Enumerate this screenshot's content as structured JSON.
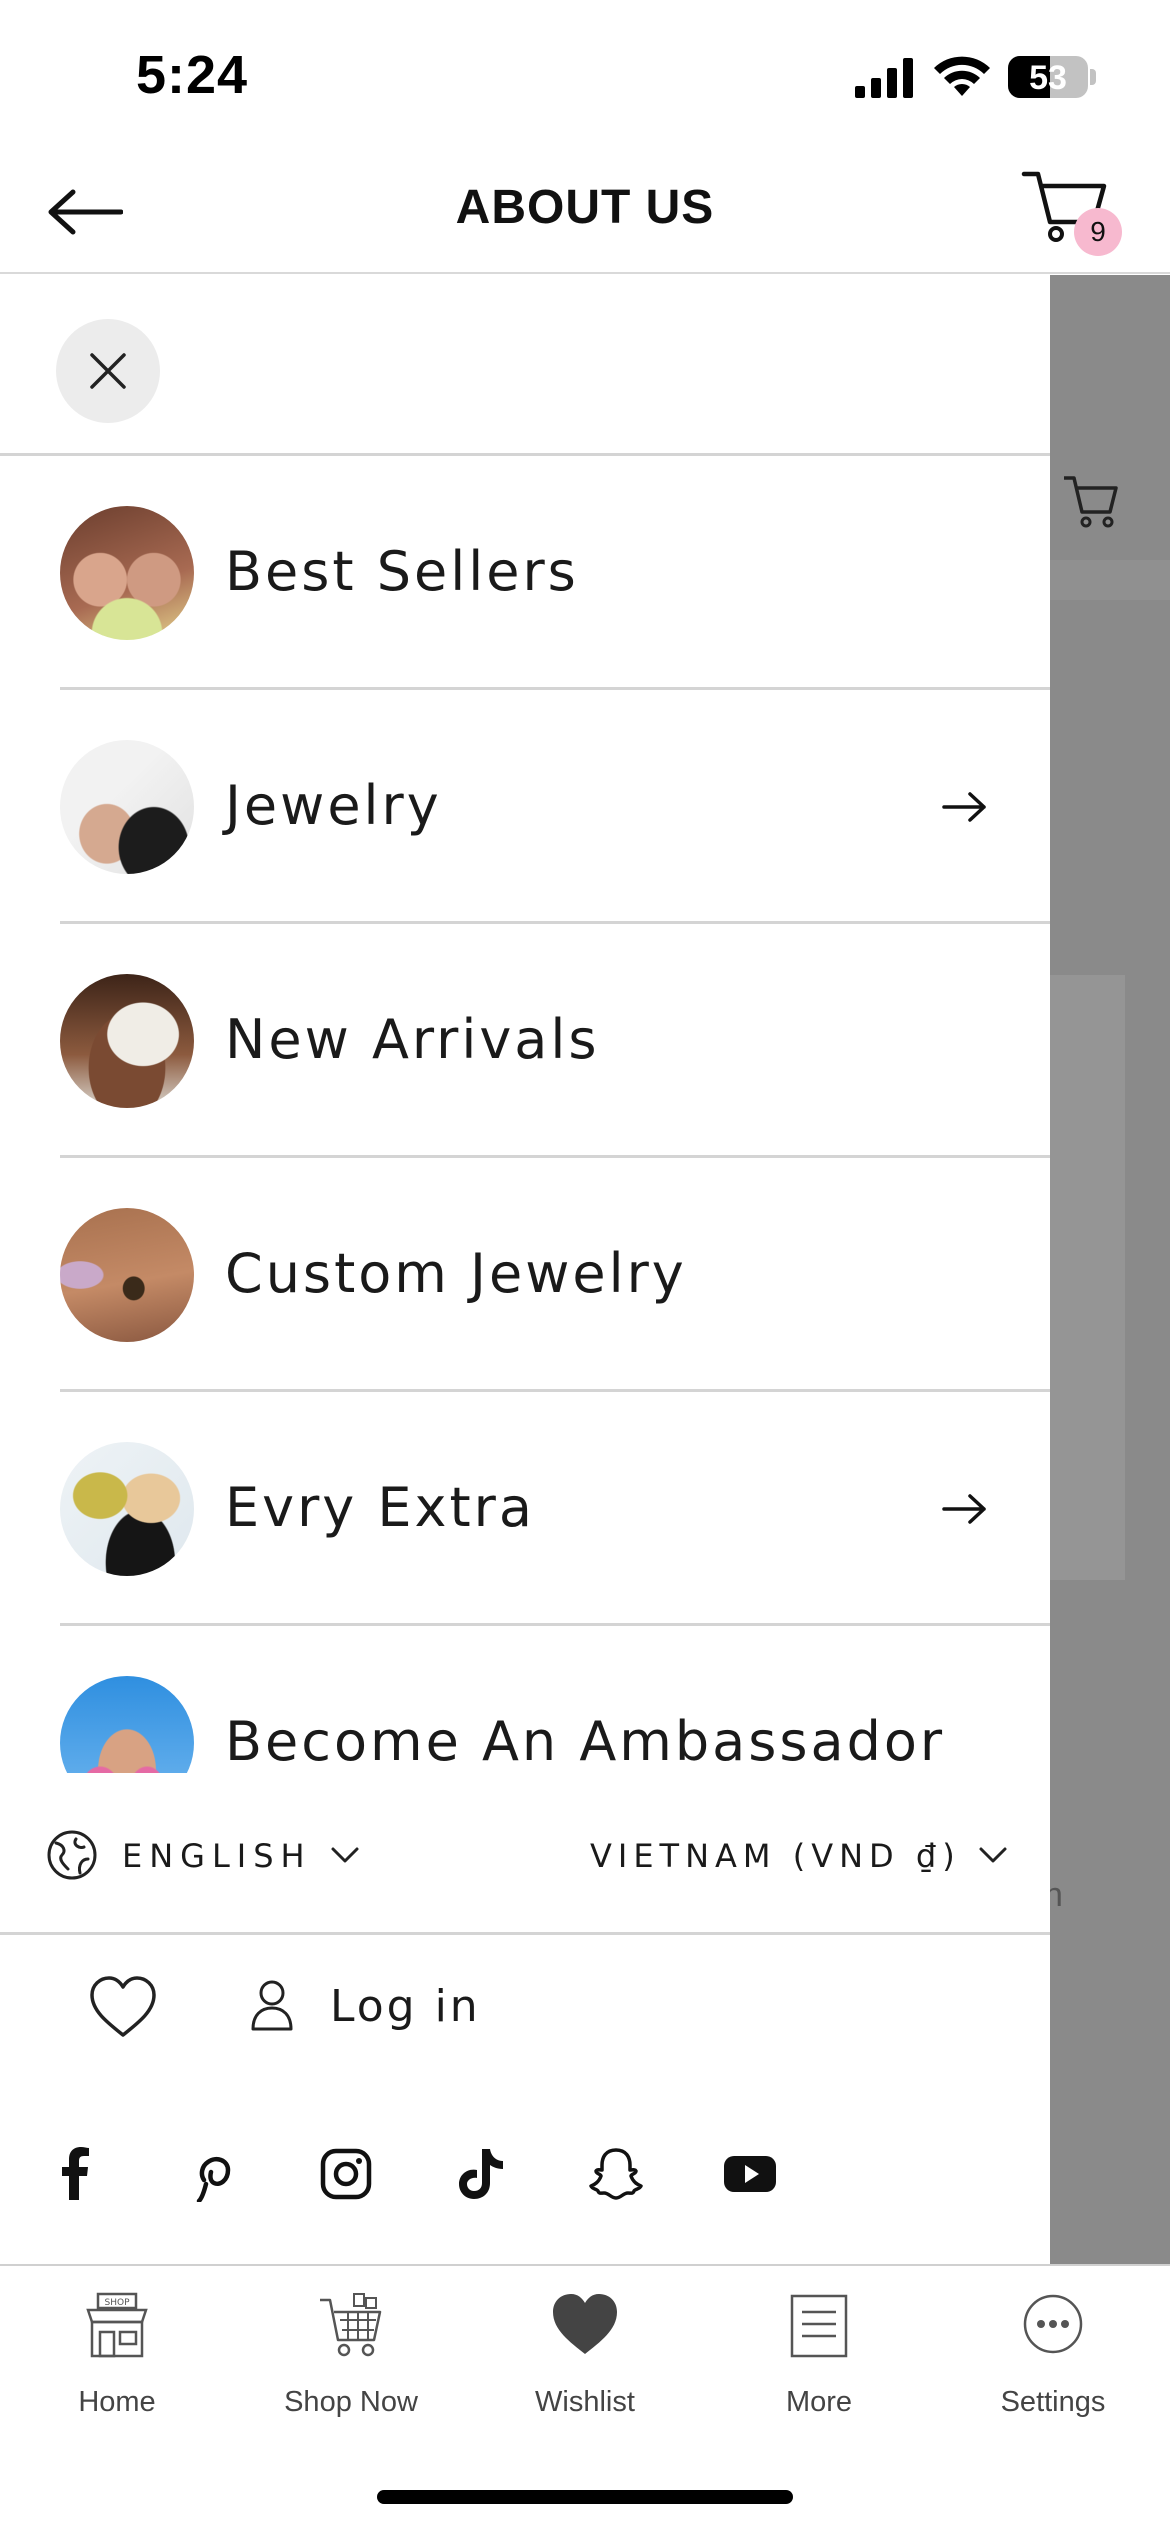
{
  "status_bar": {
    "time": "5:24",
    "battery": "53",
    "battery_level": 0.53
  },
  "header": {
    "title": "ABOUT US",
    "cart_count": "9"
  },
  "drawer": {
    "menu_items": [
      {
        "label": "Best Sellers",
        "has_arrow": false
      },
      {
        "label": "Jewelry",
        "has_arrow": true
      },
      {
        "label": "New Arrivals",
        "has_arrow": false
      },
      {
        "label": "Custom Jewelry",
        "has_arrow": false
      },
      {
        "label": "Evry Extra",
        "has_arrow": true
      },
      {
        "label": "Become An Ambassador",
        "has_arrow": false
      }
    ],
    "language": "ENGLISH",
    "currency": "VIETNAM (VND ₫)",
    "login_label": "Log in",
    "social_icons": [
      "facebook-icon",
      "pinterest-icon",
      "instagram-icon",
      "tiktok-icon",
      "snapchat-icon",
      "youtube-icon"
    ]
  },
  "backdrop": {
    "peek_letter": "n"
  },
  "tab_bar": {
    "tabs": [
      {
        "label": "Home",
        "icon": "shop-storefront-icon"
      },
      {
        "label": "Shop Now",
        "icon": "shopping-cart-icon"
      },
      {
        "label": "Wishlist",
        "icon": "heart-icon"
      },
      {
        "label": "More",
        "icon": "list-icon"
      },
      {
        "label": "Settings",
        "icon": "more-dots-icon"
      }
    ]
  },
  "colors": {
    "badge": "#f7b9cf",
    "backdrop": "#8a8a8a",
    "divider": "#d4d4d4"
  }
}
